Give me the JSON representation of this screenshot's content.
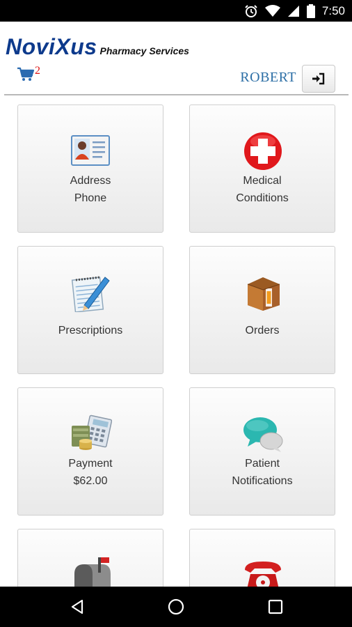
{
  "status_bar": {
    "time": "7:50",
    "icons": [
      "alarm-icon",
      "wifi-icon",
      "signal-icon",
      "battery-icon"
    ]
  },
  "header": {
    "brand": "NoviXus",
    "subtitle": "Pharmacy Services",
    "cart_count": "2",
    "user_name": "ROBERT"
  },
  "tiles": [
    {
      "line1": "Address",
      "line2": "Phone",
      "icon": "contact-card-icon"
    },
    {
      "line1": "Medical",
      "line2": "Conditions",
      "icon": "medical-cross-icon"
    },
    {
      "line1": "Prescriptions",
      "line2": "",
      "icon": "notepad-pencil-icon"
    },
    {
      "line1": "Orders",
      "line2": "",
      "icon": "package-box-icon"
    },
    {
      "line1": "Payment",
      "line2": "$62.00",
      "icon": "money-calculator-icon"
    },
    {
      "line1": "Patient",
      "line2": "Notifications",
      "icon": "chat-bubbles-icon"
    },
    {
      "line1": "",
      "line2": "",
      "icon": "mailbox-icon"
    },
    {
      "line1": "",
      "line2": "",
      "icon": "telephone-icon"
    }
  ],
  "nav": [
    "back-icon",
    "home-icon",
    "recents-icon"
  ],
  "colors": {
    "brand": "#0d3a8c",
    "user": "#2d6fa6",
    "badge": "#dd1111"
  }
}
